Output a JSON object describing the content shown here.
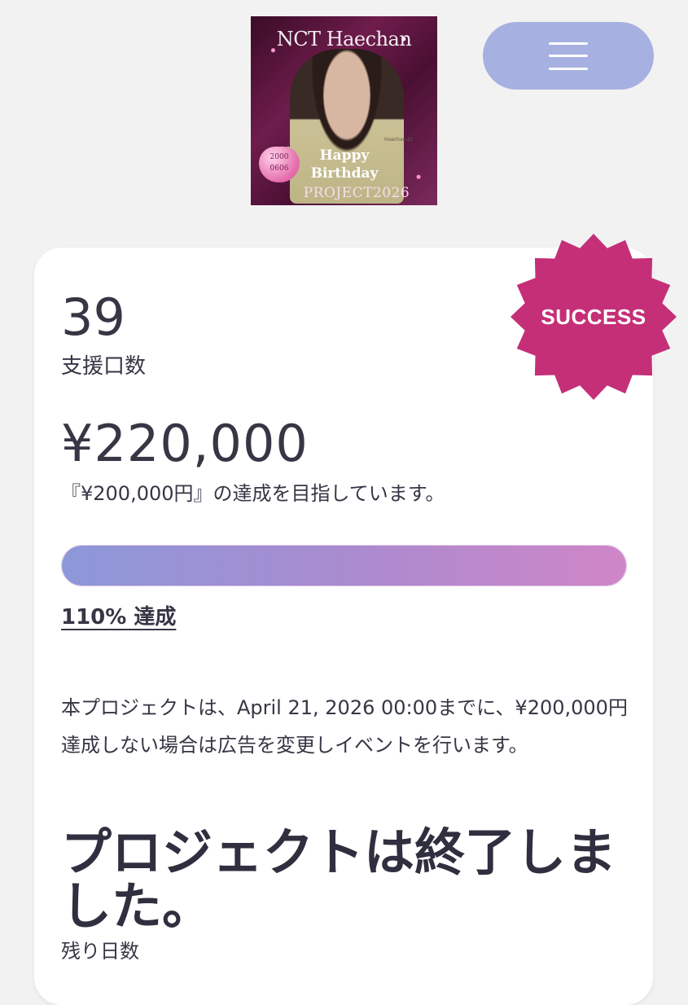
{
  "header": {
    "banner": {
      "title": "NCT Haechan",
      "greeting_line1": "Happy",
      "greeting_line2": "Birthday",
      "project_text": "PROJECT2026",
      "heart_line1": "2000",
      "heart_line2": "0606",
      "signature": "Haechan-Di"
    },
    "menu_icon": "hamburger-menu-icon"
  },
  "project": {
    "status_badge": "SUCCESS",
    "backers_count": "39",
    "backers_label": "支援口数",
    "amount_raised": "¥220,000",
    "goal_text": "『¥200,000円』の達成を目指しています。",
    "progress_percent": 110,
    "progress_label": "110% 達成",
    "deadline_text": "本プロジェクトは、April 21, 2026 00:00までに、¥200,000円達成しない場合は広告を変更しイベントを行います。",
    "ended_heading": "プロジェクトは終了しました。",
    "remaining_days_label": "残り日数"
  },
  "colors": {
    "accent_menu": "#a6b1e1",
    "badge": "#c52f78",
    "progress_start": "#8c98d9",
    "progress_end": "#cf86c7",
    "text": "#363645"
  }
}
